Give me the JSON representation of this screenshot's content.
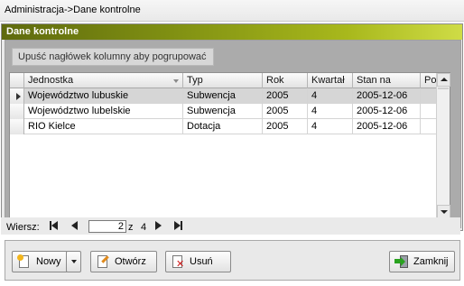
{
  "window": {
    "title": "Administracja->Dane kontrolne"
  },
  "panel": {
    "header": "Dane kontrolne",
    "group_hint": "Upuść nagłówek kolumny aby pogrupować"
  },
  "grid": {
    "columns": [
      "Jednostka",
      "Typ",
      "Rok",
      "Kwartał",
      "Stan na",
      "Po..."
    ],
    "rows": [
      [
        "Województwo lubuskie",
        "Subwencja",
        "2005",
        "4",
        "2005-12-06",
        ""
      ],
      [
        "Województwo lubelskie",
        "Subwencja",
        "2005",
        "4",
        "2005-12-06",
        ""
      ],
      [
        "RIO Kielce",
        "Dotacja",
        "2005",
        "4",
        "2005-12-06",
        ""
      ]
    ],
    "selected_row": 0
  },
  "navigator": {
    "label": "Wiersz:",
    "current": "2",
    "of": "z",
    "total": "4"
  },
  "buttons": {
    "new": "Nowy",
    "open": "Otwórz",
    "delete": "Usuń",
    "close": "Zamknij"
  },
  "icons": {
    "new": "new-document-icon",
    "open": "edit-document-icon",
    "delete": "delete-document-icon",
    "close": "exit-door-icon"
  },
  "colors": {
    "header_gradient_start": "#5f6a0e",
    "header_gradient_end": "#cfdc46",
    "selected_row": "#d6d6d6"
  }
}
